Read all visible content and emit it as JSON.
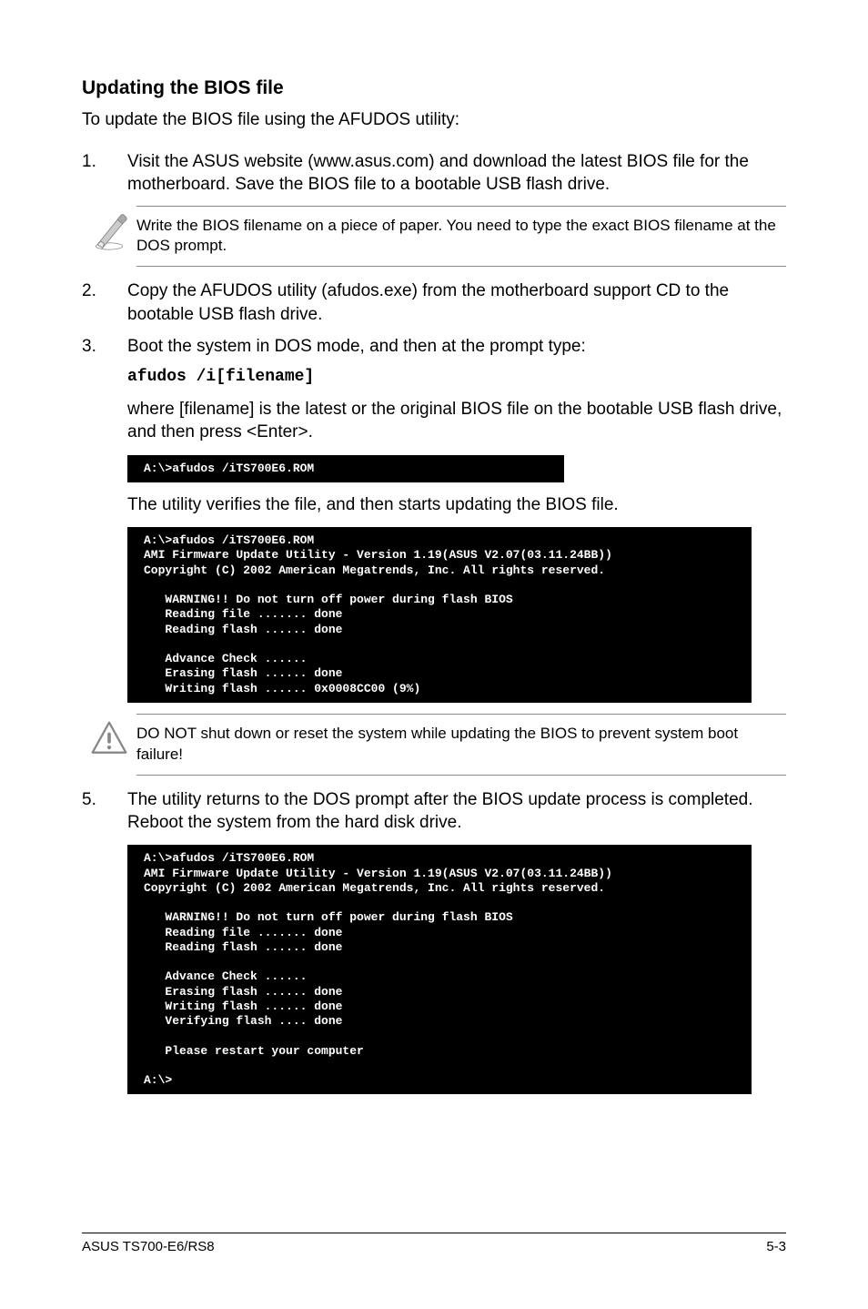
{
  "heading": "Updating the BIOS file",
  "intro": "To update the BIOS file using the AFUDOS utility:",
  "step1": {
    "num": "1.",
    "text": "Visit the ASUS website (www.asus.com) and download the latest BIOS file for the motherboard. Save the BIOS file to a bootable USB flash drive."
  },
  "note1": "Write the BIOS filename on a piece of paper. You need to type the exact BIOS filename at the DOS prompt.",
  "step2": {
    "num": "2.",
    "text": "Copy the AFUDOS utility (afudos.exe) from the motherboard support CD to the bootable USB flash drive."
  },
  "step3": {
    "num": "3.",
    "text": "Boot the system in DOS mode, and then at the prompt type:"
  },
  "cmd": "afudos /i[filename]",
  "step3b": "where [filename] is the latest or the original BIOS file on the bootable USB flash drive, and then press <Enter>.",
  "terminal1": "A:\\>afudos /iTS700E6.ROM",
  "step3c": "The utility verifies the file, and then starts updating the BIOS file.",
  "terminal2": "A:\\>afudos /iTS700E6.ROM\nAMI Firmware Update Utility - Version 1.19(ASUS V2.07(03.11.24BB))\nCopyright (C) 2002 American Megatrends, Inc. All rights reserved.\n\n   WARNING!! Do not turn off power during flash BIOS\n   Reading file ....... done\n   Reading flash ...... done\n\n   Advance Check ......\n   Erasing flash ...... done\n   Writing flash ...... 0x0008CC00 (9%)",
  "note2": "DO NOT shut down or reset the system while updating the BIOS to prevent system boot failure!",
  "step5": {
    "num": "5.",
    "text": "The utility returns to the DOS prompt after the BIOS update process is completed. Reboot the system from the hard disk drive."
  },
  "terminal3": "A:\\>afudos /iTS700E6.ROM\nAMI Firmware Update Utility - Version 1.19(ASUS V2.07(03.11.24BB))\nCopyright (C) 2002 American Megatrends, Inc. All rights reserved.\n\n   WARNING!! Do not turn off power during flash BIOS\n   Reading file ....... done\n   Reading flash ...... done\n\n   Advance Check ......\n   Erasing flash ...... done\n   Writing flash ...... done\n   Verifying flash .... done\n\n   Please restart your computer\n\nA:\\>",
  "footer_left": "ASUS TS700-E6/RS8",
  "footer_right": "5-3"
}
